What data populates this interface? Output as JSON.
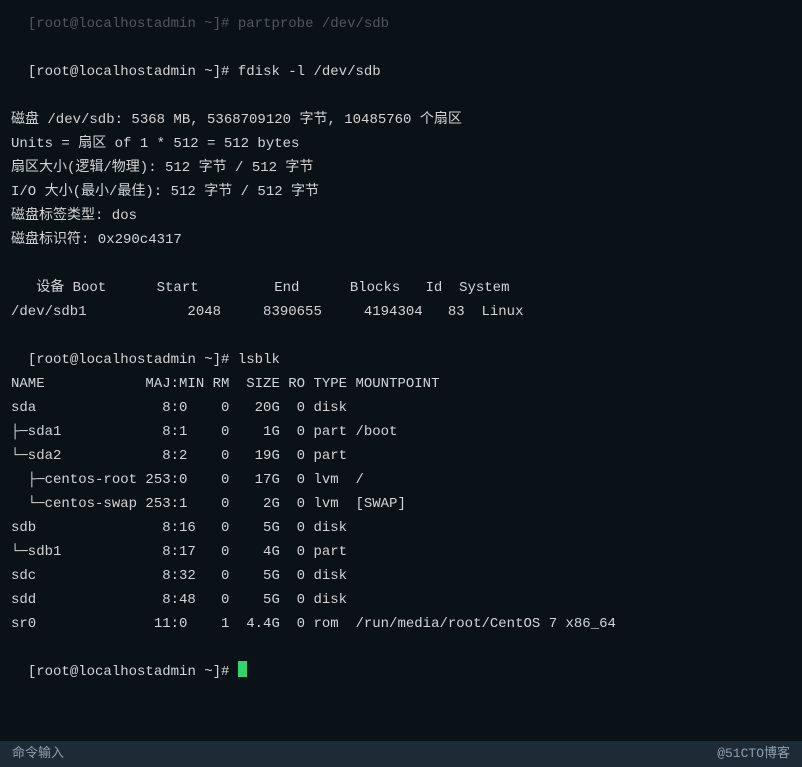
{
  "prompt_pre": "[root@localhostadmin ~]# ",
  "cmds": {
    "partprobe": "partprobe /dev/sdb",
    "fdisk": "fdisk -l /dev/sdb",
    "lsblk": "lsblk"
  },
  "fdisk_output": {
    "disk_line": "磁盘 /dev/sdb: 5368 MB, 5368709120 字节, 10485760 个扇区",
    "units_line": "Units = 扇区 of 1 * 512 = 512 bytes",
    "sector_line": "扇区大小(逻辑/物理): 512 字节 / 512 字节",
    "io_line": "I/O 大小(最小/最佳): 512 字节 / 512 字节",
    "label_line": "磁盘标签类型: dos",
    "id_line": "磁盘标识符: 0x290c4317",
    "header": "   设备 Boot      Start         End      Blocks   Id  System",
    "row1": "/dev/sdb1            2048     8390655     4194304   83  Linux"
  },
  "lsblk_output": {
    "header": "NAME            MAJ:MIN RM  SIZE RO TYPE MOUNTPOINT",
    "rows": [
      "sda               8:0    0   20G  0 disk ",
      "├─sda1            8:1    0    1G  0 part /boot",
      "└─sda2            8:2    0   19G  0 part ",
      "  ├─centos-root 253:0    0   17G  0 lvm  /",
      "  └─centos-swap 253:1    0    2G  0 lvm  [SWAP]",
      "sdb               8:16   0    5G  0 disk ",
      "└─sdb1            8:17   0    4G  0 part ",
      "sdc               8:32   0    5G  0 disk ",
      "sdd               8:48   0    5G  0 disk ",
      "sr0              11:0    1  4.4G  0 rom  /run/media/root/CentOS 7 x86_64"
    ]
  },
  "bottom": {
    "left": "命令输入",
    "right": "@51CTO博客"
  }
}
